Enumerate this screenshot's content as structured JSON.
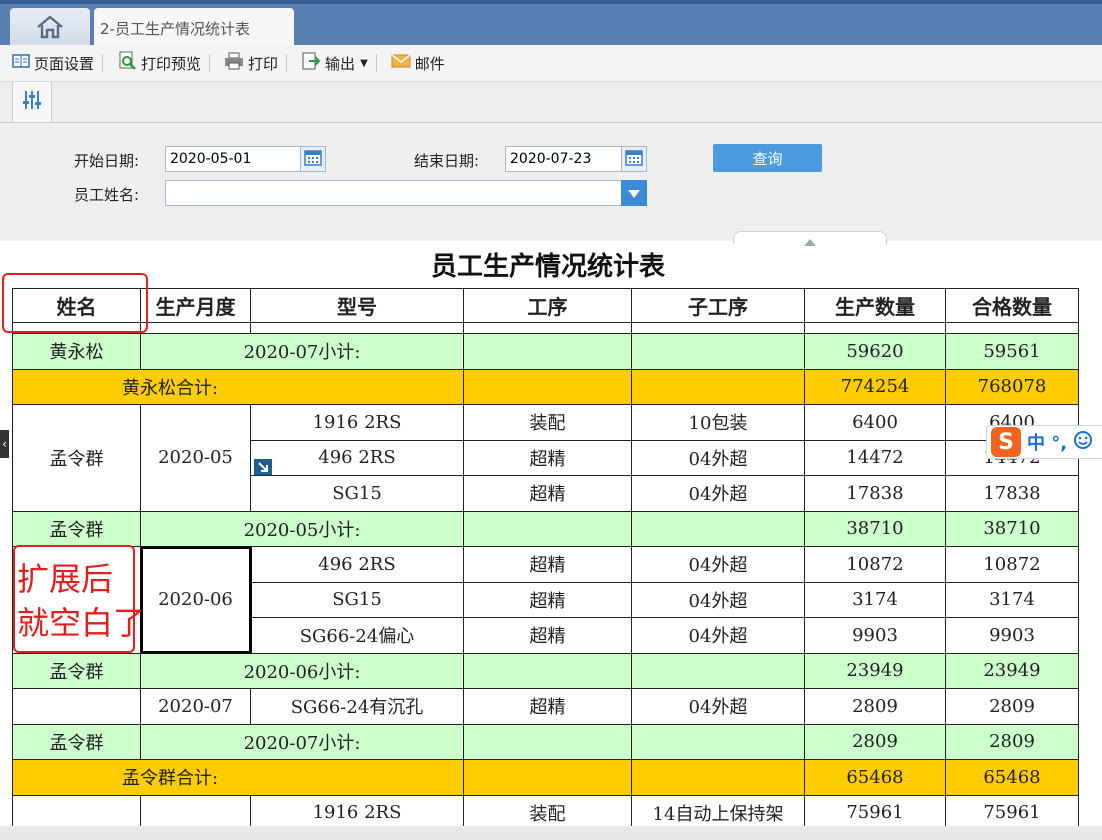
{
  "tabs": {
    "home_icon": "home-icon",
    "active_tab_label": "2-员工生产情况统计表"
  },
  "toolbar": {
    "page_setup": "页面设置",
    "print_preview": "打印预览",
    "print": "打印",
    "export": "输出",
    "mail": "邮件"
  },
  "filters": {
    "start_label": "开始日期:",
    "start_value": "2020-05-01",
    "end_label": "结束日期:",
    "end_value": "2020-07-23",
    "name_label": "员工姓名:",
    "name_value": "",
    "query_button": "查询"
  },
  "report": {
    "title": "员工生产情况统计表",
    "headers": [
      "姓名",
      "生产月度",
      "型号",
      "工序",
      "子工序",
      "生产数量",
      "合格数量"
    ],
    "rows": {
      "r1": {
        "name": "黄永松",
        "subtotal": "2020-07小计:",
        "qty": "59620",
        "ok": "59561"
      },
      "r2": {
        "total": "黄永松合计:",
        "qty": "774254",
        "ok": "768078"
      },
      "r3": {
        "name": "孟令群",
        "month": "2020-05",
        "model": "1916 2RS",
        "proc": "装配",
        "sub": "10包装",
        "qty": "6400",
        "ok": "6400"
      },
      "r4": {
        "model": "496 2RS",
        "proc": "超精",
        "sub": "04外超",
        "qty": "14472",
        "ok": "14472"
      },
      "r5": {
        "model": "SG15",
        "proc": "超精",
        "sub": "04外超",
        "qty": "17838",
        "ok": "17838"
      },
      "r6": {
        "name": "孟令群",
        "subtotal": "2020-05小计:",
        "qty": "38710",
        "ok": "38710"
      },
      "r7": {
        "month": "2020-06",
        "model": "496 2RS",
        "proc": "超精",
        "sub": "04外超",
        "qty": "10872",
        "ok": "10872"
      },
      "r8": {
        "model": "SG15",
        "proc": "超精",
        "sub": "04外超",
        "qty": "3174",
        "ok": "3174"
      },
      "r9": {
        "model": "SG66-24偏心",
        "proc": "超精",
        "sub": "04外超",
        "qty": "9903",
        "ok": "9903"
      },
      "r10": {
        "name": "孟令群",
        "subtotal": "2020-06小计:",
        "qty": "23949",
        "ok": "23949"
      },
      "r11": {
        "month": "2020-07",
        "model": "SG66-24有沉孔",
        "proc": "超精",
        "sub": "04外超",
        "qty": "2809",
        "ok": "2809"
      },
      "r12": {
        "name": "孟令群",
        "subtotal": "2020-07小计:",
        "qty": "2809",
        "ok": "2809"
      },
      "r13": {
        "total": "孟令群合计:",
        "qty": "65468",
        "ok": "65468"
      },
      "r14": {
        "model": "1916 2RS",
        "proc": "装配",
        "sub": "14自动上保持架",
        "qty": "75961",
        "ok": "75961"
      }
    }
  },
  "annotation": {
    "note": "扩展后\n就空白了",
    "color": "#e02020"
  },
  "ime": {
    "logo": "S",
    "mode": "中 °,",
    "emoji_icon": "smile-icon"
  },
  "colors": {
    "subtotal_row": "#ccffcc",
    "total_row": "#ffcc00",
    "query_button": "#4a9be0",
    "tabbar": "#5a7fb2"
  }
}
